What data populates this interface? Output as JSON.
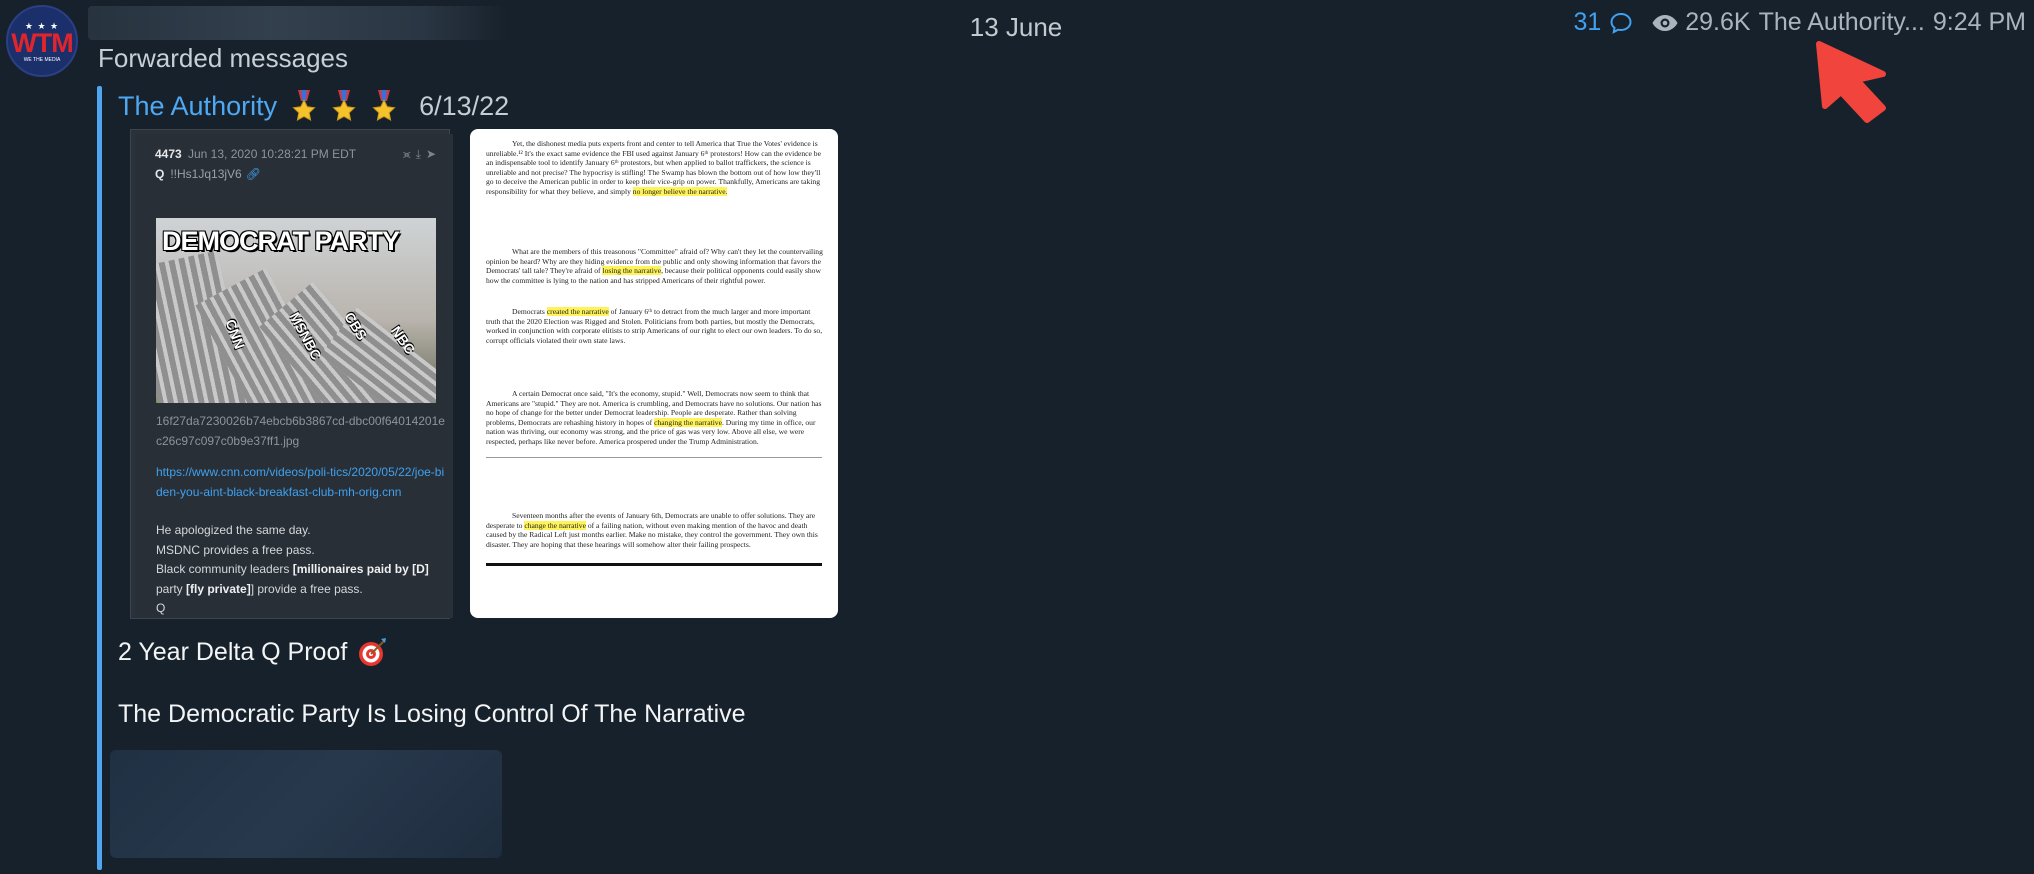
{
  "channel": {
    "avatar": {
      "stars": "★ ★ ★",
      "logo_text": "WTM",
      "logo_sub": "WE THE MEDIA"
    }
  },
  "header": {
    "date": "13 June",
    "replies": "31",
    "views": "29.6K",
    "author_short": "The Authority...",
    "time": "9:24 PM"
  },
  "message": {
    "forwarded_label": "Forwarded messages",
    "author": "The Authority",
    "author_date": "6/13/22",
    "caption_line1": "2 Year Delta Q Proof",
    "caption_line2": "The Democratic Party Is Losing Control Of The Narrative"
  },
  "q_post": {
    "number": "4473",
    "date": "Jun 13, 2020 10:28:21 PM EDT",
    "user": "Q",
    "tripcode": "!!Hs1Jq13jV6",
    "meme_title": "DEMOCRAT PARTY",
    "meme_labels": [
      "CNN",
      "MSNBC",
      "CBS",
      "NBC"
    ],
    "filename": "16f27da7230026b74ebcb6b3867cd-dbc00f64014201ec26c97c097c0b9e37ff1.jpg",
    "link": "https://www.cnn.com/videos/poli-tics/2020/05/22/joe-biden-you-aint-black-breakfast-club-mh-orig.cnn",
    "line1": "He apologized the same day.",
    "line2": "MSDNC provides a free pass.",
    "line3_a": "Black community leaders ",
    "line3_b": "[millionaires paid by [D]",
    "line4_a": "party ",
    "line4_b": "[fly private]",
    "line4_c": "] provide a free pass.",
    "signature": "Q"
  },
  "document": {
    "p1_a": "Yet, the dishonest media puts experts front and center to tell America that True the Votes' evidence is unreliable.¹² It's the exact same evidence the FBI used against January 6ᵗʰ protestors! How can the evidence be an indispensable tool to identify January 6ᵗʰ protestors, but when applied to ballot traffickers, the science is unreliable and not precise? The hypocrisy is stifling! The Swamp has blown the bottom out of how low they'll go to deceive the American public in order to keep their vice-grip on power. Thankfully, Americans are taking responsibility for what they believe, and simply ",
    "p1_mark": "no longer believe the narrative.",
    "p2_a": "What are the members of this treasonous \"Committee\" afraid of? Why can't they let the countervailing opinion be heard? Why are they hiding evidence from the public and only showing information that favors the Democrats' tall tale? They're afraid of ",
    "p2_mark": "losing the narrative",
    "p2_b": ", because their political opponents could easily show how the committee is lying to the nation and has stripped Americans of their rightful power.",
    "p3_a": "Democrats ",
    "p3_mark": "created the narrative",
    "p3_b": " of January 6ᵗʰ to detract from the much larger and more important truth that the 2020 Election was Rigged and Stolen. Politicians from both parties, but mostly the Democrats, worked in conjunction with corporate elitists to strip Americans of our right to elect our own leaders. To do so, corrupt officials violated their own state laws.",
    "p4_a": "A certain Democrat once said, \"It's the economy, stupid.\" Well, Democrats now seem to think that Americans are \"stupid.\" They are not. America is crumbling, and Democrats have no solutions. Our nation has no hope of change for the better under Democrat leadership. People are desperate. Rather than solving problems, Democrats are rehashing history in hopes of ",
    "p4_mark": "changing the narrative",
    "p4_b": ". During my time in office, our nation was thriving, our economy was strong, and the price of gas was very low. Above all else, we were respected, perhaps like never before. America prospered under the Trump Administration.",
    "p5_a": "Seventeen months after the events of January 6th, Democrats are unable to offer solutions. They are desperate to ",
    "p5_mark": "change the narrative",
    "p5_b": " of a failing nation, without even making mention of the havoc and death caused by the Radical Left just months earlier. Make no mistake, they control the government. They own this disaster. They are hoping that these hearings will somehow alter their failing prospects."
  },
  "icons": {
    "replies": "comment-bubble-icon",
    "views": "eye-icon",
    "medals": "medal-icon",
    "target": "direct-hit-target-icon",
    "arrow": "red-pointer-arrow"
  },
  "colors": {
    "background": "#17212b",
    "accent": "#4fa5f0",
    "highlight": "#fff35a",
    "arrow": "#f0443d"
  }
}
